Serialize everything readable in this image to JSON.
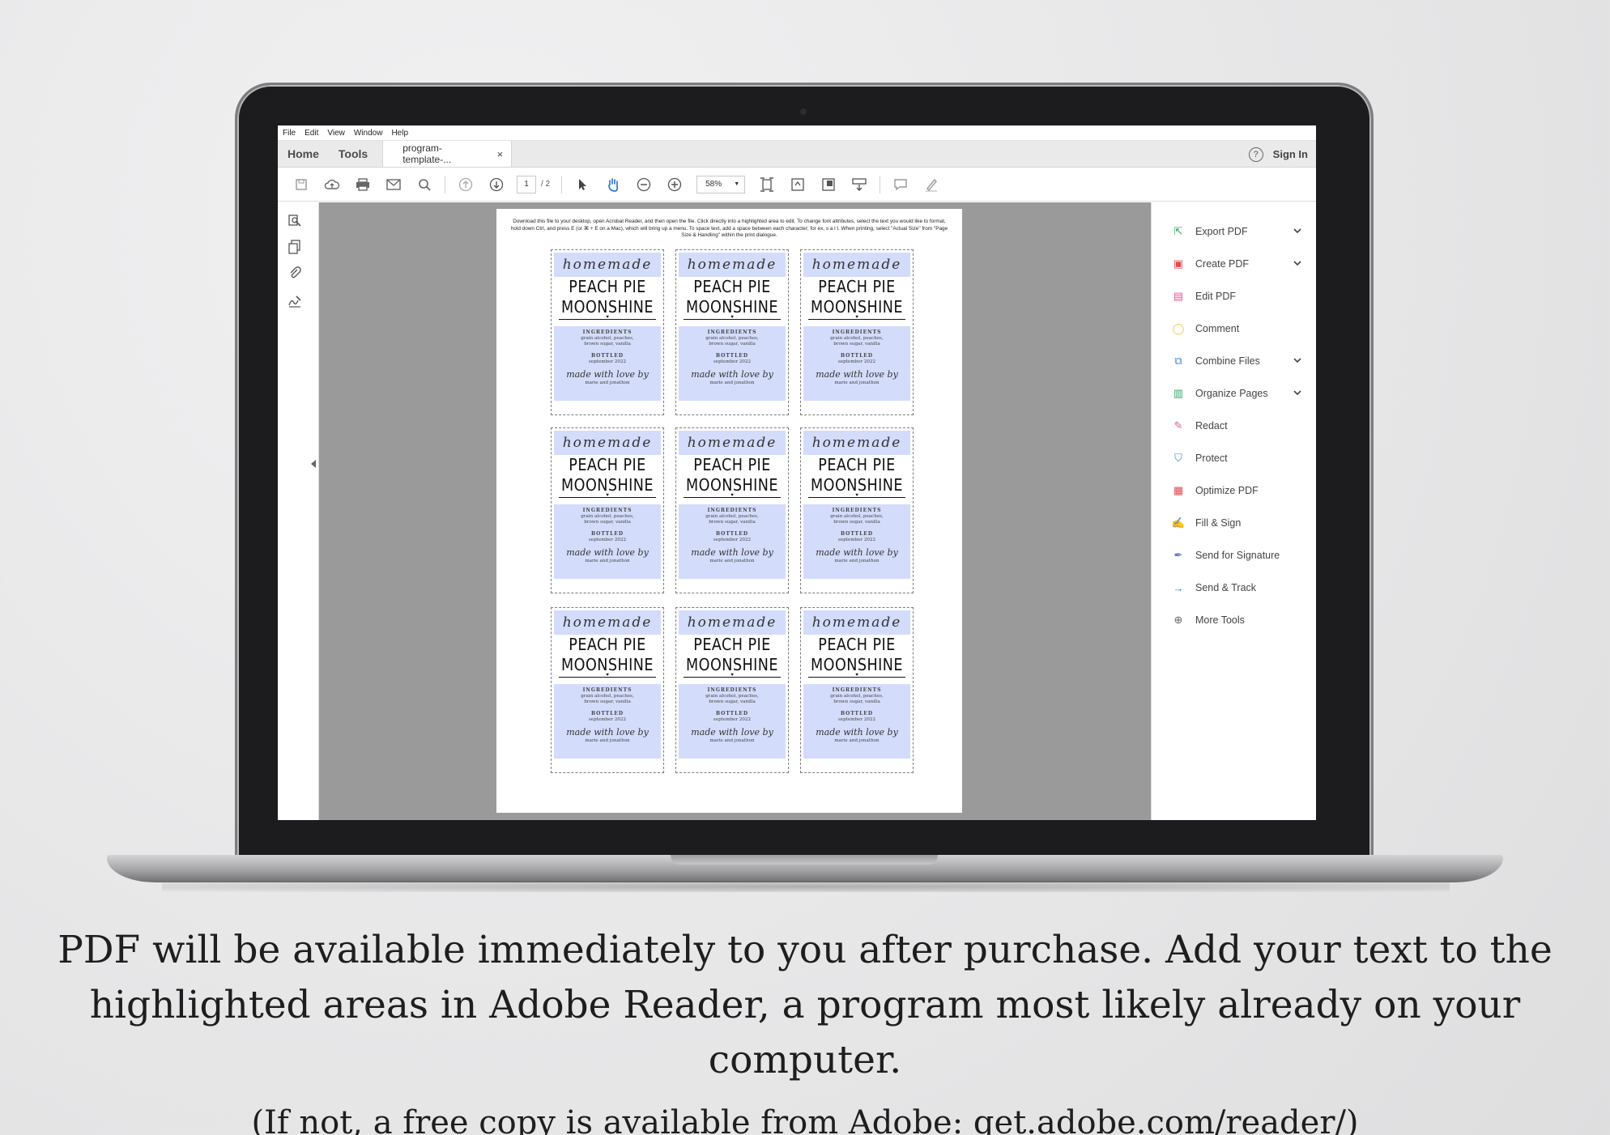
{
  "menubar": [
    "File",
    "Edit",
    "View",
    "Window",
    "Help"
  ],
  "tabs": {
    "home": "Home",
    "tools": "Tools",
    "document": "program-template-...",
    "close": "×"
  },
  "header": {
    "help": "?",
    "sign_in": "Sign In"
  },
  "toolbar": {
    "page_current": "1",
    "page_total": "/ 2",
    "zoom": "58%"
  },
  "document": {
    "instructions": "Download this file to your desktop, open Acrobat Reader, and then open the file.  Click directly into a highlighted area to edit. To change font attributes, select the text you would like to format, hold down Ctrl, and press E (or ⌘ + E on a Mac), which will bring up a menu.  To space text, add a space between each character; for ex, s a l t.  When printing, select \"Actual Size\" from \"Page Size & Handling\" within the print dialogue.",
    "label": {
      "script_top": "homemade",
      "title_line1": "PEACH PIE",
      "title_line2": "MOONSHINE",
      "ingredients_head": "INGREDIENTS",
      "ingredients_line1": "grain alcohol, peaches,",
      "ingredients_line2": "brown sugar, vanilla",
      "bottled_head": "BOTTLED",
      "bottled_date": "september 2022",
      "signature": "made with love by",
      "names": "marie and jonathon"
    }
  },
  "tools_panel": [
    {
      "label": "Export PDF",
      "icon": "export-pdf-icon",
      "color": "#3aa56a",
      "chevron": true
    },
    {
      "label": "Create PDF",
      "icon": "create-pdf-icon",
      "color": "#e0494f",
      "chevron": true
    },
    {
      "label": "Edit PDF",
      "icon": "edit-pdf-icon",
      "color": "#e0599a",
      "chevron": false
    },
    {
      "label": "Comment",
      "icon": "comment-icon",
      "color": "#f0c23b",
      "chevron": false
    },
    {
      "label": "Combine Files",
      "icon": "combine-files-icon",
      "color": "#3a86d6",
      "chevron": true
    },
    {
      "label": "Organize Pages",
      "icon": "organize-pages-icon",
      "color": "#3aa56a",
      "chevron": true
    },
    {
      "label": "Redact",
      "icon": "redact-icon",
      "color": "#e0599a",
      "chevron": false
    },
    {
      "label": "Protect",
      "icon": "protect-icon",
      "color": "#3a86d6",
      "chevron": false
    },
    {
      "label": "Optimize PDF",
      "icon": "optimize-pdf-icon",
      "color": "#e0494f",
      "chevron": false
    },
    {
      "label": "Fill & Sign",
      "icon": "fill-sign-icon",
      "color": "#7a6fd6",
      "chevron": false
    },
    {
      "label": "Send for Signature",
      "icon": "send-for-signature-icon",
      "color": "#5a6fd6",
      "chevron": false
    },
    {
      "label": "Send & Track",
      "icon": "send-track-icon",
      "color": "#3a86d6",
      "chevron": false
    },
    {
      "label": "More Tools",
      "icon": "more-tools-icon",
      "color": "#666666",
      "chevron": false
    }
  ],
  "caption": {
    "line1": "PDF will be available immediately to you after purchase.  Add your text to the",
    "line2": "highlighted areas in Adobe Reader, a program most likely already on your computer.",
    "line3": "(If not, a free copy is available from Adobe: get.adobe.com/reader/)"
  }
}
